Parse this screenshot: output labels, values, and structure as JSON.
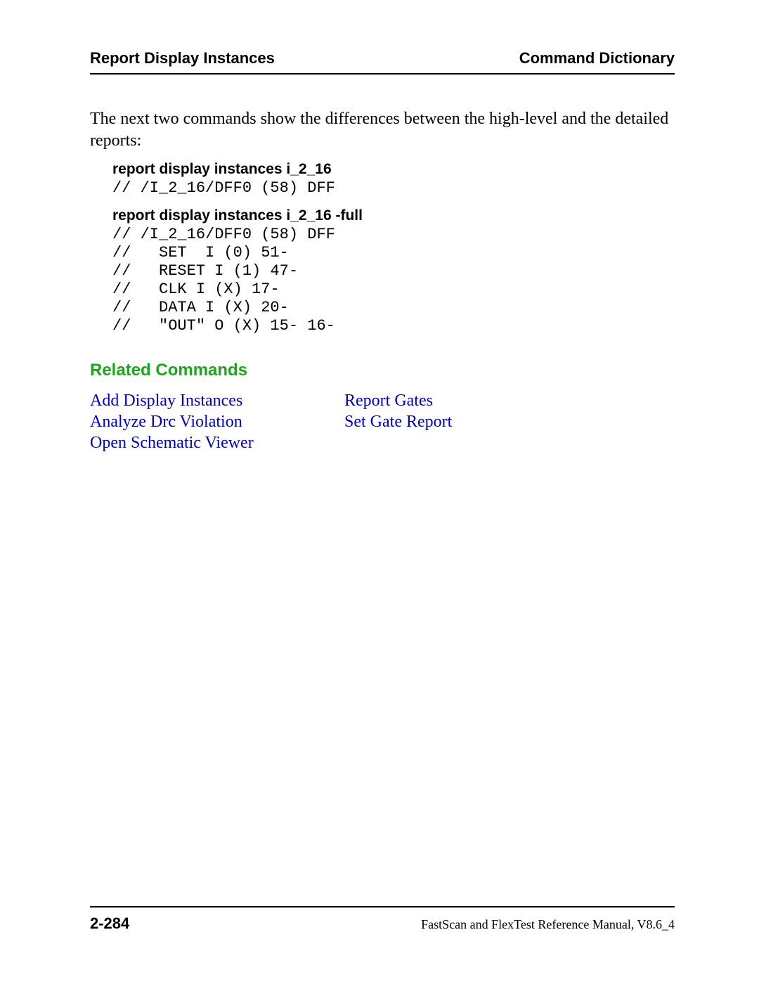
{
  "header": {
    "left": "Report Display Instances",
    "right": "Command Dictionary"
  },
  "intro": "The next two commands show the differences between the high-level and the detailed reports:",
  "block1": {
    "heading": "report display instances i_2_16",
    "code": "// /I_2_16/DFF0 (58) DFF"
  },
  "block2": {
    "heading": "report display instances i_2_16 -full",
    "code": "// /I_2_16/DFF0 (58) DFF\n//   SET  I (0) 51-\n//   RESET I (1) 47-\n//   CLK I (X) 17-\n//   DATA I (X) 20-\n//   \"OUT\" O (X) 15- 16-"
  },
  "related": {
    "heading": "Related Commands",
    "left": [
      "Add Display Instances",
      "Analyze Drc Violation",
      "Open Schematic Viewer"
    ],
    "right": [
      "Report Gates",
      "Set Gate Report"
    ]
  },
  "footer": {
    "page": "2-284",
    "manual": "FastScan and FlexTest Reference Manual, V8.6_4"
  }
}
